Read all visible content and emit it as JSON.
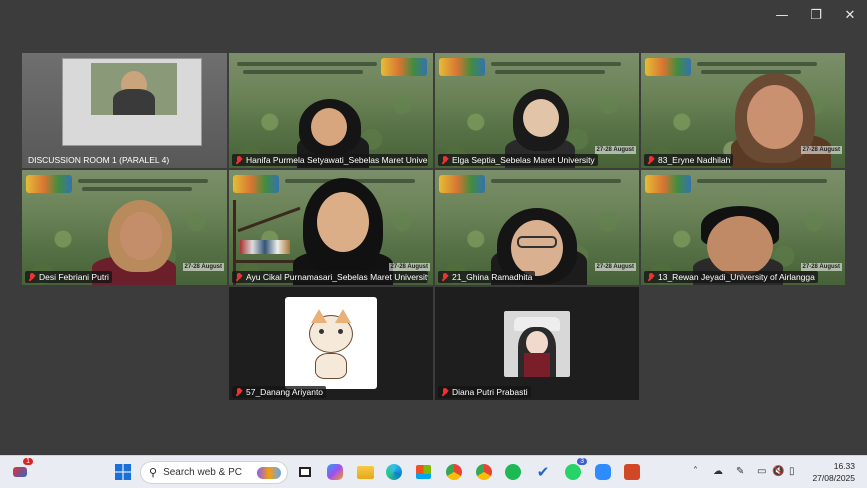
{
  "window_controls": {
    "minimize": "—",
    "restore": "❐",
    "close": "✕"
  },
  "tiles": [
    {
      "name": "DISCUSSION ROOM 1 (PARALEL 4)",
      "muted": false
    },
    {
      "name": "Hanifa Purmela Setyawati_Sebelas Maret Univer...",
      "muted": true
    },
    {
      "name": "Elga Septia_Sebelas Maret University",
      "muted": true
    },
    {
      "name": "83_Eryne Nadhilah",
      "muted": true
    },
    {
      "name": "Desi Febriani Putri",
      "muted": true
    },
    {
      "name": "Ayu Cikal Purnamasari_Sebelas Maret University",
      "muted": true
    },
    {
      "name": "21_Ghina Ramadhita",
      "muted": true
    },
    {
      "name": "13_Rewan Jeyadi_University of Airlangga",
      "muted": true
    },
    {
      "name": "57_Danang Ariyanto",
      "muted": true
    },
    {
      "name": "Diana Putri Prabasti",
      "muted": true
    }
  ],
  "banner_date": "27-28 August",
  "taskbar": {
    "search_placeholder": "Search web & PC",
    "notification_count": "1",
    "whatsapp_badge": "3",
    "time": "16.33",
    "date": "27/08/2025"
  },
  "icons": [
    "windows-start-icon",
    "search-icon",
    "task-view-icon",
    "copilot-icon",
    "file-explorer-icon",
    "edge-icon",
    "store-icon",
    "chrome-icon",
    "chrome-profile-icon",
    "spotify-icon",
    "todo-icon",
    "whatsapp-icon",
    "zoom-icon",
    "powerpoint-icon"
  ]
}
